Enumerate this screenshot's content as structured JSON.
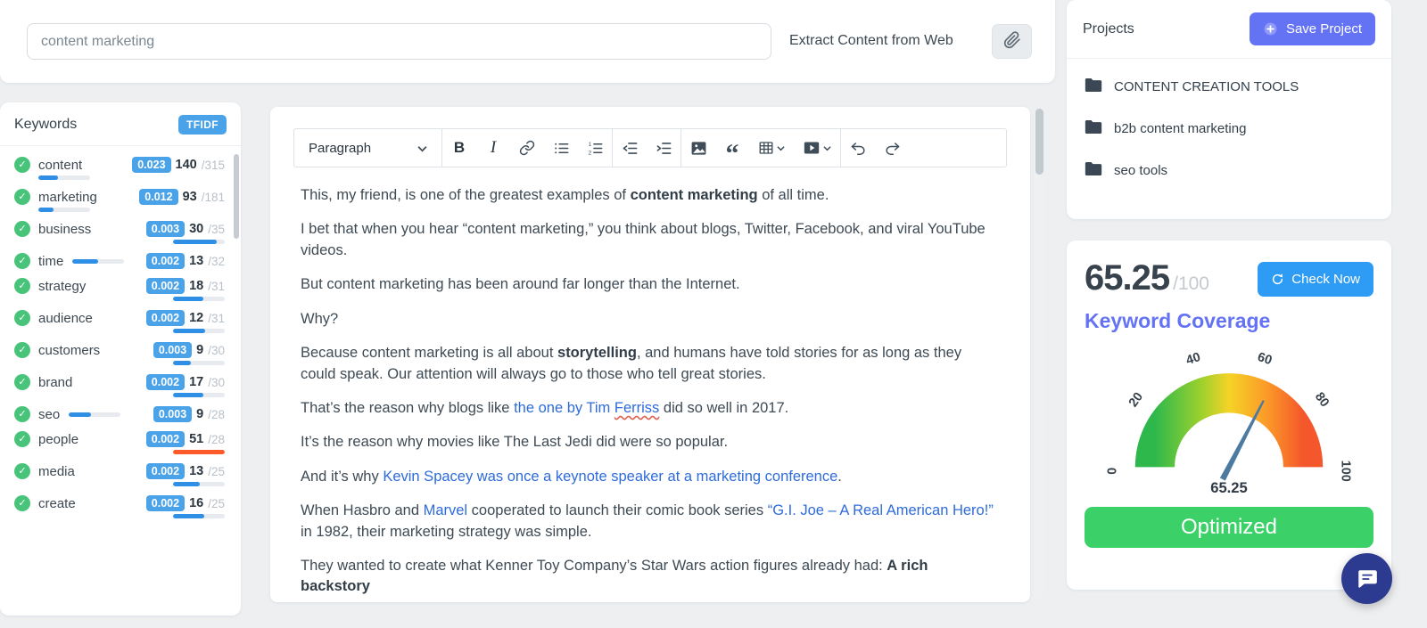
{
  "colors": {
    "accent_blue": "#4aa3e8",
    "accent_purple": "#6472f4",
    "button_blue": "#2e9cf4",
    "success_green": "#3bd168",
    "check_green": "#47c479",
    "bar_blue": "#2f8fe5",
    "bar_orange": "#ff5a2a",
    "link_blue": "#2e6bdb",
    "chat_navy": "#2c3a8f"
  },
  "topbar": {
    "search_value": "content marketing",
    "extract_label": "Extract Content from Web"
  },
  "keywords_panel": {
    "title": "Keywords",
    "badge": "TFIDF",
    "check_glyph": "✓",
    "items": [
      {
        "term": "content",
        "score": "0.023",
        "count": "140",
        "total": "/315",
        "fill": 38,
        "color": "#2f8fe5",
        "bar_pos": "left"
      },
      {
        "term": "marketing",
        "score": "0.012",
        "count": "93",
        "total": "/181",
        "fill": 30,
        "color": "#2f8fe5",
        "bar_pos": "left"
      },
      {
        "term": "business",
        "score": "0.003",
        "count": "30",
        "total": "/35",
        "fill": 85,
        "color": "#2f8fe5",
        "bar_pos": "right"
      },
      {
        "term": "time",
        "score": "0.002",
        "count": "13",
        "total": "/32",
        "fill": 50,
        "color": "#2f8fe5",
        "bar_pos": "inline"
      },
      {
        "term": "strategy",
        "score": "0.002",
        "count": "18",
        "total": "/31",
        "fill": 58,
        "color": "#2f8fe5",
        "bar_pos": "right"
      },
      {
        "term": "audience",
        "score": "0.002",
        "count": "12",
        "total": "/31",
        "fill": 62,
        "color": "#2f8fe5",
        "bar_pos": "right"
      },
      {
        "term": "customers",
        "score": "0.003",
        "count": "9",
        "total": "/30",
        "fill": 35,
        "color": "#2f8fe5",
        "bar_pos": "right"
      },
      {
        "term": "brand",
        "score": "0.002",
        "count": "17",
        "total": "/30",
        "fill": 58,
        "color": "#2f8fe5",
        "bar_pos": "right"
      },
      {
        "term": "seo",
        "score": "0.003",
        "count": "9",
        "total": "/28",
        "fill": 42,
        "color": "#2f8fe5",
        "bar_pos": "inline"
      },
      {
        "term": "people",
        "score": "0.002",
        "count": "51",
        "total": "/28",
        "fill": 100,
        "color": "#ff5a2a",
        "bar_pos": "right"
      },
      {
        "term": "media",
        "score": "0.002",
        "count": "13",
        "total": "/25",
        "fill": 52,
        "color": "#2f8fe5",
        "bar_pos": "right"
      },
      {
        "term": "create",
        "score": "0.002",
        "count": "16",
        "total": "/25",
        "fill": 60,
        "color": "#2f8fe5",
        "bar_pos": "right"
      }
    ]
  },
  "editor": {
    "toolbar": {
      "block_format": "Paragraph",
      "bold_glyph": "B",
      "italic_glyph": "I",
      "quote_glyph": "“"
    },
    "paragraphs": [
      [
        {
          "t": "This, my friend, is one of the greatest examples of "
        },
        {
          "t": "content marketing",
          "b": true
        },
        {
          "t": " of all time."
        }
      ],
      [
        {
          "t": "I bet that when you hear “content marketing,” you think about blogs, Twitter, Facebook, and viral YouTube videos."
        }
      ],
      [
        {
          "t": "But content marketing has been around far longer than the Internet."
        }
      ],
      [
        {
          "t": "Why?"
        }
      ],
      [
        {
          "t": "Because content marketing is all about "
        },
        {
          "t": "storytelling",
          "b": true
        },
        {
          "t": ", and humans have told stories for as long as they could speak. Our attention will always go to those who tell great stories."
        }
      ],
      [
        {
          "t": "That’s the reason why blogs like "
        },
        {
          "t": "the one by Tim ",
          "link": true
        },
        {
          "t": "Ferriss",
          "link": true,
          "spell": true
        },
        {
          "t": " did so well in 2017."
        }
      ],
      [
        {
          "t": "It’s the reason why movies like The Last Jedi did were so popular."
        }
      ],
      [
        {
          "t": "And it’s why "
        },
        {
          "t": "Kevin Spacey was once a keynote speaker at a marketing conference",
          "link": true
        },
        {
          "t": "."
        }
      ],
      [
        {
          "t": "When Hasbro and "
        },
        {
          "t": "Marvel",
          "link": true
        },
        {
          "t": " cooperated to launch their comic book series "
        },
        {
          "t": "“G.I. Joe – A Real American Hero!”",
          "link": true
        },
        {
          "t": " in 1982, their marketing strategy was simple."
        }
      ],
      [
        {
          "t": "They wanted to create what Kenner Toy Company’s Star Wars action figures already had: "
        },
        {
          "t": "A rich backstory",
          "b": true
        }
      ]
    ]
  },
  "projects": {
    "title": "Projects",
    "save_button": "Save Project",
    "folders": [
      {
        "name": "CONTENT CREATION TOOLS"
      },
      {
        "name": "b2b content marketing"
      },
      {
        "name": "seo tools"
      }
    ]
  },
  "score": {
    "value": "65.25",
    "denominator": "/100",
    "check_button": "Check Now",
    "heading": "Keyword Coverage",
    "status": "Optimized",
    "gauge": {
      "labels": [
        "0",
        "20",
        "40",
        "60",
        "80",
        "100"
      ],
      "min": 0,
      "max": 100,
      "value": 65.25,
      "pointer": "65.25"
    }
  }
}
